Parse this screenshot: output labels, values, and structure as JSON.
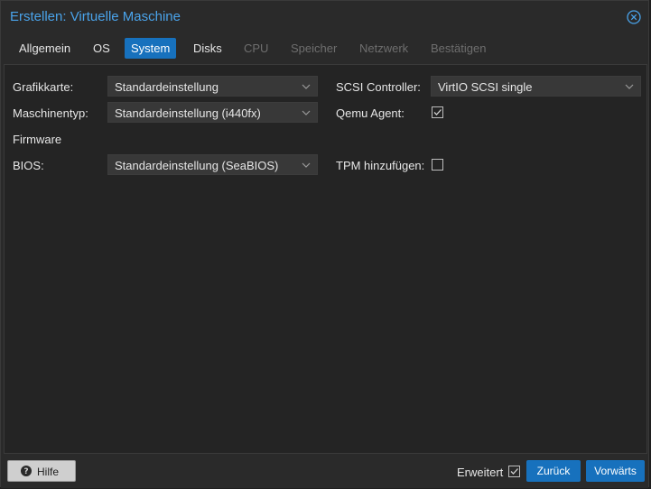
{
  "window": {
    "title": "Erstellen: Virtuelle Maschine"
  },
  "tabs": [
    {
      "label": "Allgemein",
      "state": "normal"
    },
    {
      "label": "OS",
      "state": "normal"
    },
    {
      "label": "System",
      "state": "active"
    },
    {
      "label": "Disks",
      "state": "normal"
    },
    {
      "label": "CPU",
      "state": "disabled"
    },
    {
      "label": "Speicher",
      "state": "disabled"
    },
    {
      "label": "Netzwerk",
      "state": "disabled"
    },
    {
      "label": "Bestätigen",
      "state": "disabled"
    }
  ],
  "form": {
    "graphics_label": "Grafikkarte:",
    "graphics_value": "Standardeinstellung",
    "machine_label": "Maschinentyp:",
    "machine_value": "Standardeinstellung (i440fx)",
    "firmware_heading": "Firmware",
    "bios_label": "BIOS:",
    "bios_value": "Standardeinstellung (SeaBIOS)",
    "scsi_label": "SCSI Controller:",
    "scsi_value": "VirtIO SCSI single",
    "qemu_label": "Qemu Agent:",
    "qemu_checked": true,
    "tpm_label": "TPM hinzufügen:",
    "tpm_checked": false
  },
  "footer": {
    "help_label": "Hilfe",
    "advanced_label": "Erweitert",
    "advanced_checked": true,
    "back_label": "Zurück",
    "next_label": "Vorwärts"
  },
  "colors": {
    "accent": "#1771bd",
    "title": "#4aa3ea",
    "background": "#242424"
  }
}
